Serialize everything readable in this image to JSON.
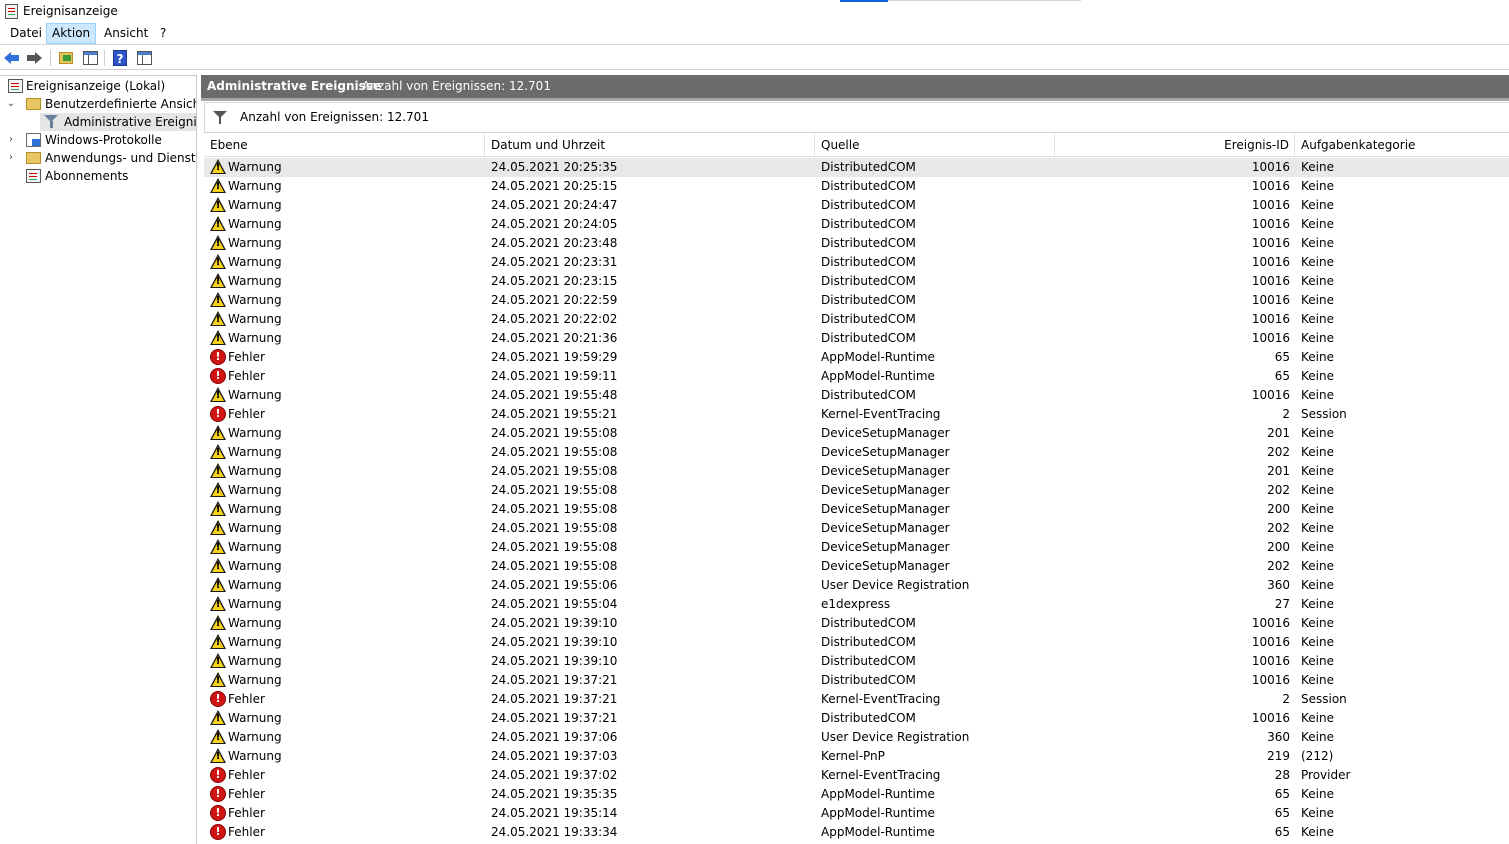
{
  "window": {
    "title": "Ereignisanzeige"
  },
  "menu": {
    "items": [
      "Datei",
      "Aktion",
      "Ansicht",
      "?"
    ]
  },
  "toolbar": {
    "buttons": [
      "back-icon",
      "forward-icon",
      "open-folder-icon",
      "show-hide-tree-icon",
      "help-icon",
      "show-hide-action-pane-icon"
    ]
  },
  "tree": {
    "root": "Ereignisanzeige (Lokal)",
    "custom_views": "Benutzerdefinierte Ansichten",
    "admin_events": "Administrative Ereignisse",
    "windows_logs": "Windows-Protokolle",
    "app_service_logs": "Anwendungs- und Dienstpro",
    "subscriptions": "Abonnements"
  },
  "header": {
    "title": "Administrative Ereignisse",
    "count": "Anzahl von Ereignissen: 12.701"
  },
  "filter": {
    "text": "Anzahl von Ereignissen: 12.701"
  },
  "columns": [
    "Ebene",
    "Datum und Uhrzeit",
    "Quelle",
    "Ereignis-ID",
    "Aufgabenkategorie"
  ],
  "events": [
    {
      "level": "Warnung",
      "type": "warning",
      "date": "24.05.2021 20:25:35",
      "source": "DistributedCOM",
      "id": "10016",
      "category": "Keine"
    },
    {
      "level": "Warnung",
      "type": "warning",
      "date": "24.05.2021 20:25:15",
      "source": "DistributedCOM",
      "id": "10016",
      "category": "Keine"
    },
    {
      "level": "Warnung",
      "type": "warning",
      "date": "24.05.2021 20:24:47",
      "source": "DistributedCOM",
      "id": "10016",
      "category": "Keine"
    },
    {
      "level": "Warnung",
      "type": "warning",
      "date": "24.05.2021 20:24:05",
      "source": "DistributedCOM",
      "id": "10016",
      "category": "Keine"
    },
    {
      "level": "Warnung",
      "type": "warning",
      "date": "24.05.2021 20:23:48",
      "source": "DistributedCOM",
      "id": "10016",
      "category": "Keine"
    },
    {
      "level": "Warnung",
      "type": "warning",
      "date": "24.05.2021 20:23:31",
      "source": "DistributedCOM",
      "id": "10016",
      "category": "Keine"
    },
    {
      "level": "Warnung",
      "type": "warning",
      "date": "24.05.2021 20:23:15",
      "source": "DistributedCOM",
      "id": "10016",
      "category": "Keine"
    },
    {
      "level": "Warnung",
      "type": "warning",
      "date": "24.05.2021 20:22:59",
      "source": "DistributedCOM",
      "id": "10016",
      "category": "Keine"
    },
    {
      "level": "Warnung",
      "type": "warning",
      "date": "24.05.2021 20:22:02",
      "source": "DistributedCOM",
      "id": "10016",
      "category": "Keine"
    },
    {
      "level": "Warnung",
      "type": "warning",
      "date": "24.05.2021 20:21:36",
      "source": "DistributedCOM",
      "id": "10016",
      "category": "Keine"
    },
    {
      "level": "Fehler",
      "type": "error",
      "date": "24.05.2021 19:59:29",
      "source": "AppModel-Runtime",
      "id": "65",
      "category": "Keine"
    },
    {
      "level": "Fehler",
      "type": "error",
      "date": "24.05.2021 19:59:11",
      "source": "AppModel-Runtime",
      "id": "65",
      "category": "Keine"
    },
    {
      "level": "Warnung",
      "type": "warning",
      "date": "24.05.2021 19:55:48",
      "source": "DistributedCOM",
      "id": "10016",
      "category": "Keine"
    },
    {
      "level": "Fehler",
      "type": "error",
      "date": "24.05.2021 19:55:21",
      "source": "Kernel-EventTracing",
      "id": "2",
      "category": "Session"
    },
    {
      "level": "Warnung",
      "type": "warning",
      "date": "24.05.2021 19:55:08",
      "source": "DeviceSetupManager",
      "id": "201",
      "category": "Keine"
    },
    {
      "level": "Warnung",
      "type": "warning",
      "date": "24.05.2021 19:55:08",
      "source": "DeviceSetupManager",
      "id": "202",
      "category": "Keine"
    },
    {
      "level": "Warnung",
      "type": "warning",
      "date": "24.05.2021 19:55:08",
      "source": "DeviceSetupManager",
      "id": "201",
      "category": "Keine"
    },
    {
      "level": "Warnung",
      "type": "warning",
      "date": "24.05.2021 19:55:08",
      "source": "DeviceSetupManager",
      "id": "202",
      "category": "Keine"
    },
    {
      "level": "Warnung",
      "type": "warning",
      "date": "24.05.2021 19:55:08",
      "source": "DeviceSetupManager",
      "id": "200",
      "category": "Keine"
    },
    {
      "level": "Warnung",
      "type": "warning",
      "date": "24.05.2021 19:55:08",
      "source": "DeviceSetupManager",
      "id": "202",
      "category": "Keine"
    },
    {
      "level": "Warnung",
      "type": "warning",
      "date": "24.05.2021 19:55:08",
      "source": "DeviceSetupManager",
      "id": "200",
      "category": "Keine"
    },
    {
      "level": "Warnung",
      "type": "warning",
      "date": "24.05.2021 19:55:08",
      "source": "DeviceSetupManager",
      "id": "202",
      "category": "Keine"
    },
    {
      "level": "Warnung",
      "type": "warning",
      "date": "24.05.2021 19:55:06",
      "source": "User Device Registration",
      "id": "360",
      "category": "Keine"
    },
    {
      "level": "Warnung",
      "type": "warning",
      "date": "24.05.2021 19:55:04",
      "source": "e1dexpress",
      "id": "27",
      "category": "Keine"
    },
    {
      "level": "Warnung",
      "type": "warning",
      "date": "24.05.2021 19:39:10",
      "source": "DistributedCOM",
      "id": "10016",
      "category": "Keine"
    },
    {
      "level": "Warnung",
      "type": "warning",
      "date": "24.05.2021 19:39:10",
      "source": "DistributedCOM",
      "id": "10016",
      "category": "Keine"
    },
    {
      "level": "Warnung",
      "type": "warning",
      "date": "24.05.2021 19:39:10",
      "source": "DistributedCOM",
      "id": "10016",
      "category": "Keine"
    },
    {
      "level": "Warnung",
      "type": "warning",
      "date": "24.05.2021 19:37:21",
      "source": "DistributedCOM",
      "id": "10016",
      "category": "Keine"
    },
    {
      "level": "Fehler",
      "type": "error",
      "date": "24.05.2021 19:37:21",
      "source": "Kernel-EventTracing",
      "id": "2",
      "category": "Session"
    },
    {
      "level": "Warnung",
      "type": "warning",
      "date": "24.05.2021 19:37:21",
      "source": "DistributedCOM",
      "id": "10016",
      "category": "Keine"
    },
    {
      "level": "Warnung",
      "type": "warning",
      "date": "24.05.2021 19:37:06",
      "source": "User Device Registration",
      "id": "360",
      "category": "Keine"
    },
    {
      "level": "Warnung",
      "type": "warning",
      "date": "24.05.2021 19:37:03",
      "source": "Kernel-PnP",
      "id": "219",
      "category": "(212)"
    },
    {
      "level": "Fehler",
      "type": "error",
      "date": "24.05.2021 19:37:02",
      "source": "Kernel-EventTracing",
      "id": "28",
      "category": "Provider"
    },
    {
      "level": "Fehler",
      "type": "error",
      "date": "24.05.2021 19:35:35",
      "source": "AppModel-Runtime",
      "id": "65",
      "category": "Keine"
    },
    {
      "level": "Fehler",
      "type": "error",
      "date": "24.05.2021 19:35:14",
      "source": "AppModel-Runtime",
      "id": "65",
      "category": "Keine"
    },
    {
      "level": "Fehler",
      "type": "error",
      "date": "24.05.2021 19:33:34",
      "source": "AppModel-Runtime",
      "id": "65",
      "category": "Keine"
    }
  ]
}
